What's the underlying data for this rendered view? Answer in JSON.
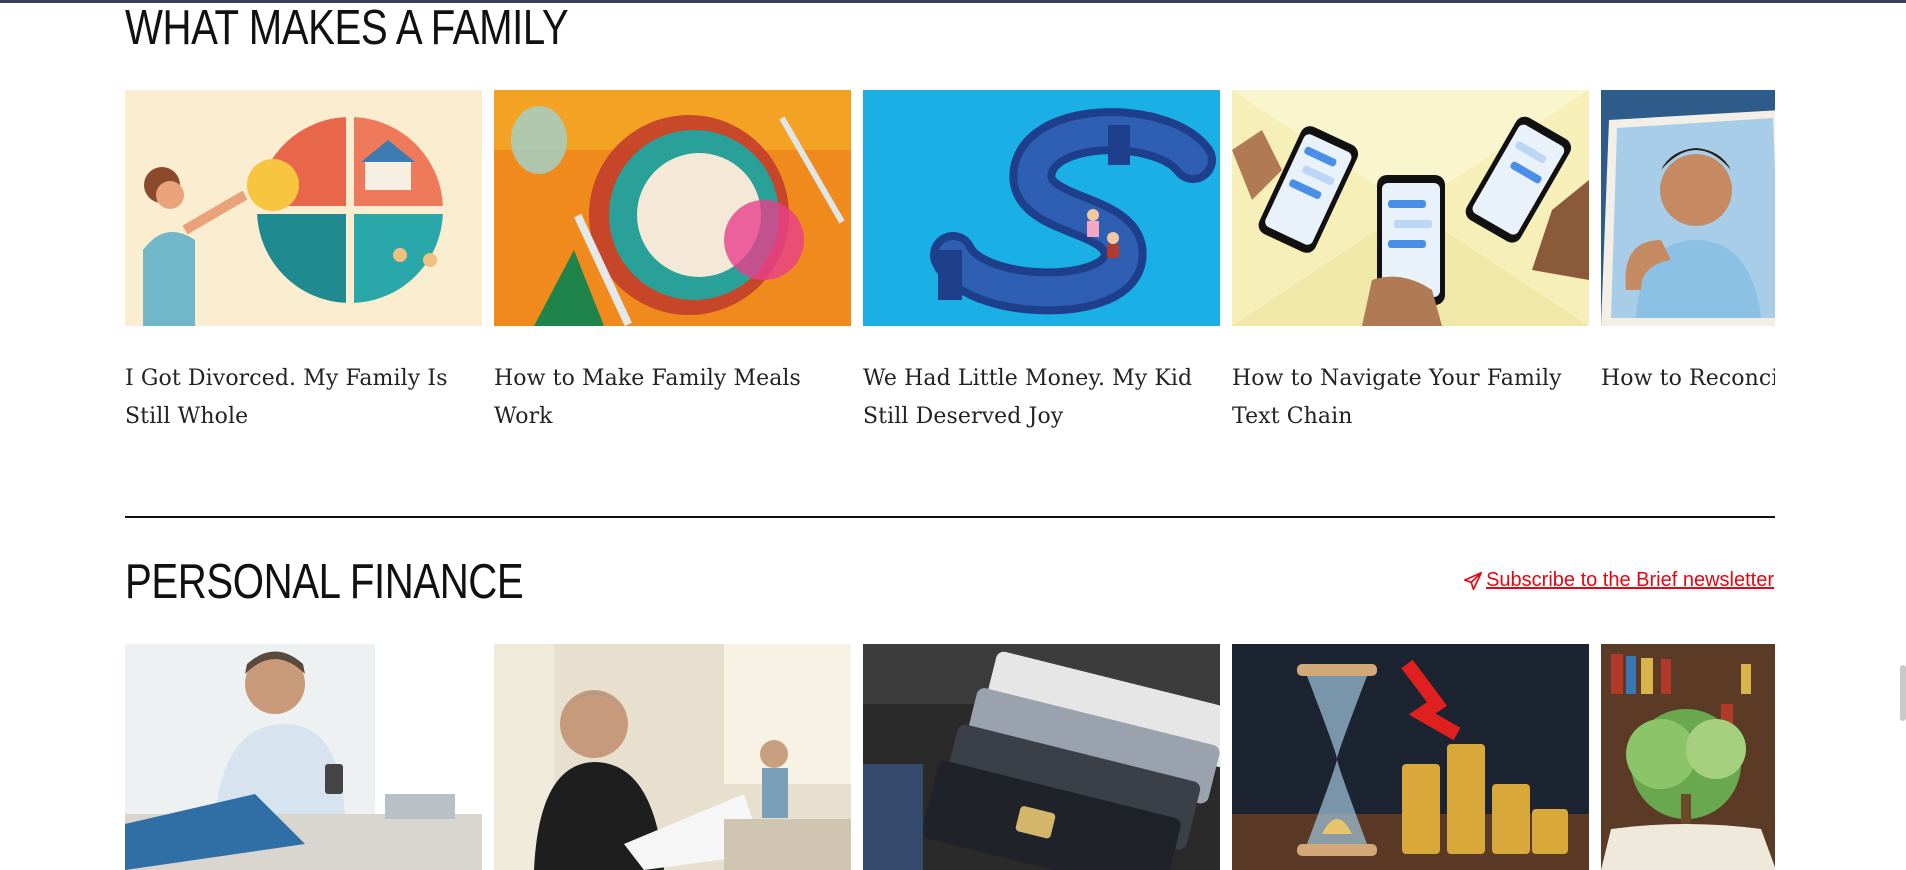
{
  "sections": {
    "family": {
      "heading": "WHAT MAKES A FAMILY",
      "cards": [
        {
          "title": "I Got Divorced. My Family Is Still Whole",
          "image": "family-puzzle-illustration"
        },
        {
          "title": "How to Make Family Meals Work",
          "image": "family-meal-illustration"
        },
        {
          "title": "We Had Little Money. My Kid Still Deserved Joy",
          "image": "dollar-sign-illustration"
        },
        {
          "title": "How to Navigate Your Family Text Chain",
          "image": "phones-text-chain-illustration"
        },
        {
          "title": "How to Reconcile with Estranged Relatives",
          "image": "estranged-relative-illustration"
        }
      ]
    },
    "finance": {
      "heading": "PERSONAL FINANCE",
      "subscribe_label": "Subscribe to the Brief newsletter",
      "cards": [
        {
          "image": "man-relaxing-with-phone-photo"
        },
        {
          "image": "man-reading-bills-photo"
        },
        {
          "image": "credit-cards-photo"
        },
        {
          "image": "hourglass-coins-photo"
        },
        {
          "image": "money-tree-book-photo"
        }
      ]
    }
  },
  "colors": {
    "accent_red": "#e30613",
    "heading": "#111111",
    "divider": "#111111"
  }
}
